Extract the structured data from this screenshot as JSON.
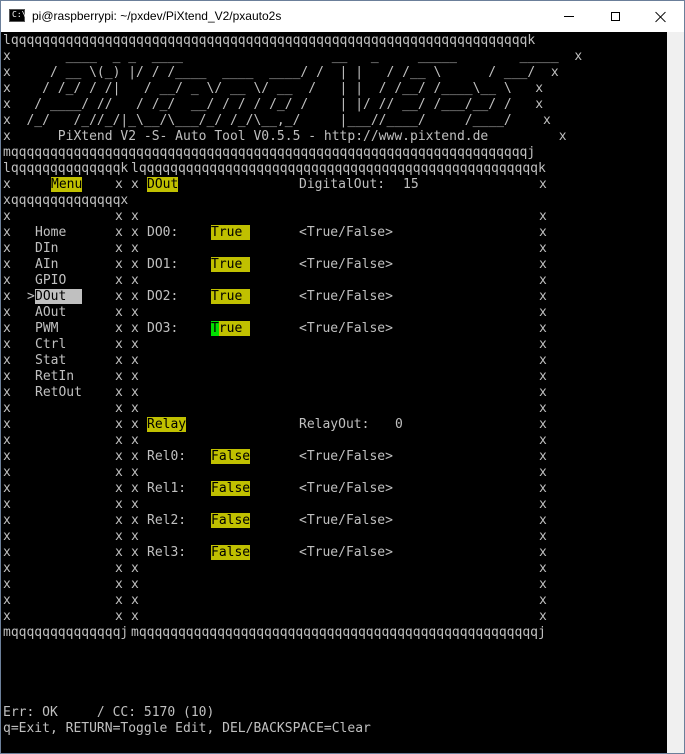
{
  "window": {
    "title": "pi@raspberrypi: ~/pxdev/PiXtend_V2/pxauto2s",
    "icon_text": "C:\\"
  },
  "banner": {
    "top_border": "lqqqqqqqqqqqqqqqqqqqqqqqqqqqqqqqqqqqqqqqqqqqqqqqqqqqqqqqqqqqqqqqqqqk",
    "art": [
      "x       ____  _ _  ____                   __   _     _____        _____  x",
      "x     / __ \\(_) |/ / /____  ____  ____/ /  | |   / /__ \\      / ___/  x",
      "x    / /_/ / /|   / __/ _ \\/ __ \\/ __  /   | |  / /__/ /____\\__ \\   x",
      "x   / ____/ //   / /_/  __/ / / / /_/ /    | |/ // __/ /___/__/ /   x",
      "x  /_/   /_//_/|_\\__/\\___/_/ /_/\\__,_/     |___//____/     /____/    x"
    ],
    "version_line": "x      PiXtend V2 -S- Auto Tool V0.5.5 - http://www.pixtend.de         x",
    "bottom_border": "mqqqqqqqqqqqqqqqqqqqqqqqqqqqqqqqqqqqqqqqqqqqqqqqqqqqqqqqqqqqqqqqqqqj"
  },
  "menu": {
    "top_border": "lqqqqqqqqqqqqqqk",
    "title": "Menu",
    "divider": "xqqqqqqqqqqqqqqx",
    "bottom_border": "mqqqqqqqqqqqqqqj",
    "items": [
      "Home",
      "DIn",
      "AIn",
      "GPIO",
      "DOut",
      "AOut",
      "PWM",
      "Ctrl",
      "Stat",
      "RetIn",
      "RetOut"
    ],
    "selected_marker": ">"
  },
  "main": {
    "top_border": "lqqqqqqqqqqqqqqqqqqqqqqqqqqqqqqqqqqqqqqqqqqqqqqqqqqqk",
    "bottom_border": "mqqqqqqqqqqqqqqqqqqqqqqqqqqqqqqqqqqqqqqqqqqqqqqqqqqqj",
    "section_title": "DOut",
    "digital_label": "DigitalOut:",
    "digital_value": "15",
    "digital_outputs": [
      {
        "name": "DO0:",
        "value": "True",
        "hint": "<True/False>"
      },
      {
        "name": "DO1:",
        "value": "True",
        "hint": "<True/False>"
      },
      {
        "name": "DO2:",
        "value": "True",
        "hint": "<True/False>"
      },
      {
        "name": "DO3:",
        "value_first": "T",
        "value_rest": "rue",
        "hint": "<True/False>"
      }
    ],
    "relay_title": "Relay",
    "relay_label": "RelayOut:",
    "relay_value": "0",
    "relays": [
      {
        "name": "Rel0:",
        "value": "False",
        "hint": "<True/False>"
      },
      {
        "name": "Rel1:",
        "value": "False",
        "hint": "<True/False>"
      },
      {
        "name": "Rel2:",
        "value": "False",
        "hint": "<True/False>"
      },
      {
        "name": "Rel3:",
        "value": "False",
        "hint": "<True/False>"
      }
    ]
  },
  "status": {
    "error_line": "Err: OK     / CC: 5170 (10)",
    "help_line": "q=Exit, RETURN=Toggle Edit, DEL/BACKSPACE=Clear"
  },
  "border_char": "x",
  "colors": {
    "highlight": "#c0c000",
    "selection": "#c0c0c0",
    "cursor": "#00e000",
    "text": "#c0c0c0",
    "background": "#000000"
  }
}
